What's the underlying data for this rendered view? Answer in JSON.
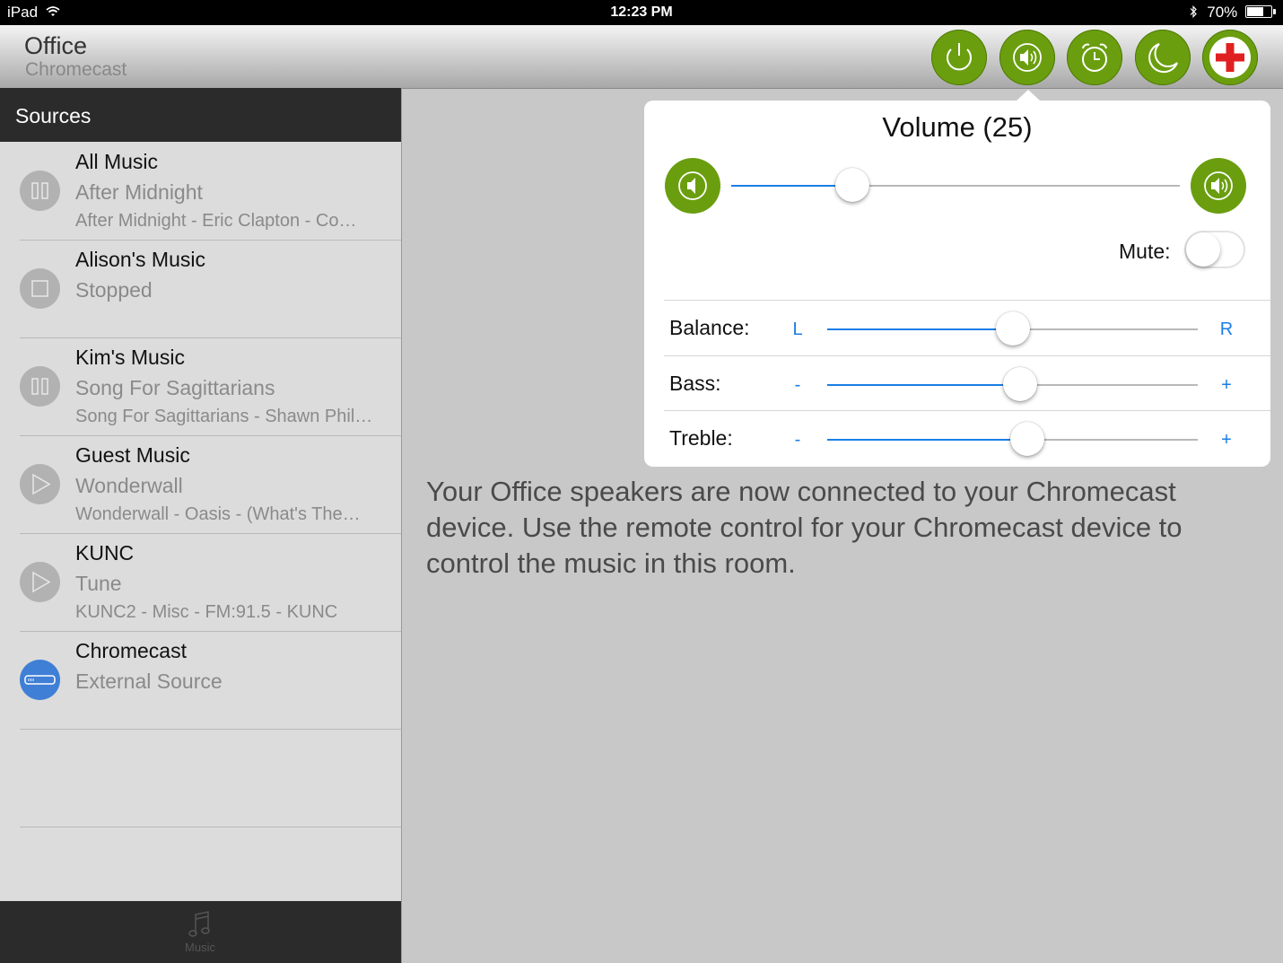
{
  "status_bar": {
    "device": "iPad",
    "time": "12:23 PM",
    "battery": "70%",
    "battery_level": 0.7
  },
  "header": {
    "room": "Office",
    "source": "Chromecast"
  },
  "header_buttons": [
    "power-icon",
    "speaker-volume-icon",
    "alarm-clock-icon",
    "moon-sleep-icon",
    "red-cross-icon"
  ],
  "sidebar": {
    "title": "Sources",
    "items": [
      {
        "name": "All Music",
        "status": "After Midnight",
        "detail": "After Midnight - Eric Clapton - Co…",
        "icon": "pause-icon"
      },
      {
        "name": "Alison's Music",
        "status": "Stopped",
        "detail": "",
        "icon": "stop-icon"
      },
      {
        "name": "Kim's Music",
        "status": "Song For Sagittarians",
        "detail": "Song For Sagittarians - Shawn Phil…",
        "icon": "pause-icon"
      },
      {
        "name": "Guest Music",
        "status": "Wonderwall",
        "detail": "Wonderwall - Oasis - (What's The…",
        "icon": "play-icon"
      },
      {
        "name": "KUNC",
        "status": "Tune",
        "detail": "KUNC2 - Misc - FM:91.5 - KUNC",
        "icon": "play-icon"
      },
      {
        "name": "Chromecast",
        "status": "External Source",
        "detail": "",
        "icon": "chromecast-device-icon"
      }
    ],
    "tab_label": "Music"
  },
  "message": "Your Office speakers are now connected to your Chromecast device.  Use the remote control for your Chromecast device to control the music in this room.",
  "volume_popover": {
    "title": "Volume (25)",
    "volume_level": 0.27,
    "mute_label": "Mute:",
    "mute_on": false,
    "balance": {
      "label": "Balance:",
      "min": "L",
      "max": "R",
      "level": 0.5
    },
    "bass": {
      "label": "Bass:",
      "min": "-",
      "max": "+",
      "level": 0.52
    },
    "treble": {
      "label": "Treble:",
      "min": "-",
      "max": "+",
      "level": 0.54
    }
  },
  "colors": {
    "accent_green": "#6a9e0f",
    "slider_blue": "#1a7ee6",
    "chromecast_blue": "#3f7fd6"
  }
}
